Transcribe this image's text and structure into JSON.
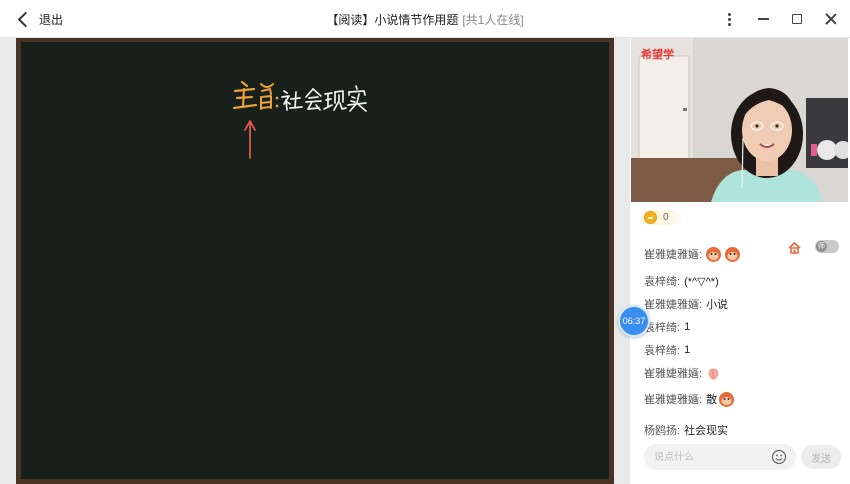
{
  "window": {
    "back_label": "退出",
    "title": "【阅读】小说情节作用题",
    "online_text": "[共1人在线]"
  },
  "board": {
    "handwriting_lines": [
      "主旨",
      "社会现实"
    ],
    "colors": {
      "background": "#17201a",
      "frame": "#4a3323",
      "orange": "#e8a03a",
      "red": "#e0574c",
      "chalk": "#f1f1f1"
    }
  },
  "video": {
    "brand_text": "希望学"
  },
  "coins": {
    "count": "0"
  },
  "chat": {
    "messages": [
      {
        "name": "崔雅婕雅婳:",
        "text": "",
        "emojis": [
          "monkey-emoji",
          "monkey-emoji"
        ]
      },
      {
        "name": "袁梓绮:",
        "text": "(*^▽^*)",
        "emojis": []
      },
      {
        "name": "崔雅婕雅婳:",
        "text": "小说",
        "emojis": []
      },
      {
        "name": "袁梓绮:",
        "text": "1",
        "emojis": []
      },
      {
        "name": "袁梓绮:",
        "text": "1",
        "emojis": []
      },
      {
        "name": "崔雅婕雅婳:",
        "text": "",
        "emojis": [
          "peach-emoji"
        ]
      },
      {
        "name": "崔雅婕雅婳:",
        "text": "散",
        "emojis": [
          "monkey-emoji"
        ]
      },
      {
        "name": "杨鸥扬:",
        "text": "社会现实",
        "emojis": []
      }
    ],
    "teacher_toggle_label": "师",
    "input_placeholder": "说点什么",
    "send_label": "发送"
  },
  "timer": {
    "time": "06:37"
  }
}
